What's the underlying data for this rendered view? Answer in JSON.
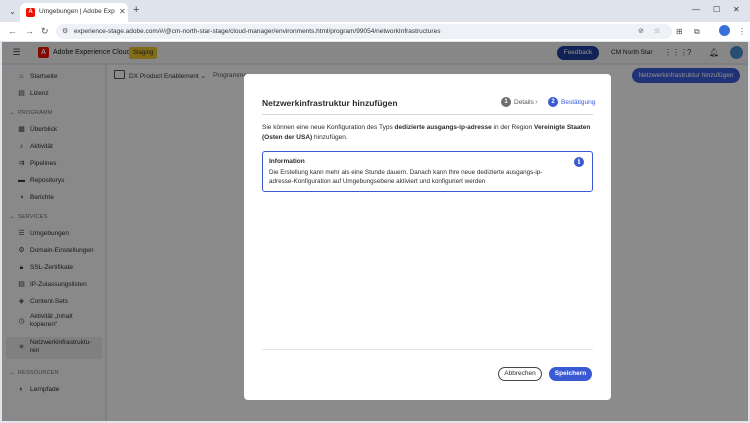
{
  "browser": {
    "tab_title": "Umgebungen | Adobe Experience",
    "url": "experience-stage.adobe.com/#/@cm-north-star-stage/cloud-manager/environments.html/program/99054/networkInfrastructures"
  },
  "header": {
    "brand": "Adobe Experience Cloud",
    "env_badge": "Staging",
    "feedback_label": "Feedback",
    "org_name": "CM North Star"
  },
  "sidebar": {
    "top_items": [
      {
        "label": "Startseite",
        "icon": "home-icon"
      },
      {
        "label": "Lizenz",
        "icon": "license-icon"
      }
    ],
    "sections": [
      {
        "title": "PROGRAMM",
        "items": [
          {
            "label": "Überblick",
            "icon": "overview-icon"
          },
          {
            "label": "Aktivität",
            "icon": "bell-icon"
          },
          {
            "label": "Pipelines",
            "icon": "pipeline-icon"
          },
          {
            "label": "Repositorys",
            "icon": "folder-icon"
          },
          {
            "label": "Berichte",
            "icon": "report-icon"
          }
        ]
      },
      {
        "title": "SERVICES",
        "items": [
          {
            "label": "Umgebungen",
            "icon": "database-icon"
          },
          {
            "label": "Domain-Einstellungen",
            "icon": "gear-icon"
          },
          {
            "label": "SSL-Zertifikate",
            "icon": "lock-icon"
          },
          {
            "label": "IP-Zulassungslisten",
            "icon": "list-icon"
          },
          {
            "label": "Content-Sets",
            "icon": "box-icon"
          },
          {
            "label": "Aktivität „Inhalt kopieren“",
            "icon": "history-icon"
          },
          {
            "label": "Netzwerkinfrastruktu­ren",
            "icon": "network-icon"
          }
        ]
      },
      {
        "title": "RESSOURCEN",
        "items": [
          {
            "label": "Lernpfade",
            "icon": "compass-icon"
          }
        ]
      }
    ]
  },
  "main": {
    "breadcrumb": "DX Product Enablement",
    "breadcrumb_next": "Programme",
    "add_button": "Netzwerkinfrastruktur hinzufügen"
  },
  "dialog": {
    "title": "Netzwerkinfrastruktur hinzufügen",
    "steps": [
      {
        "number": "1",
        "label": "Details",
        "state": "done"
      },
      {
        "number": "2",
        "label": "Bestätigung",
        "state": "active"
      }
    ],
    "body_prefix": "Sie können eine neue Konfiguration des Typs ",
    "body_type": "dedizierte ausgangs-ip-adresse",
    "body_mid": " in der Region ",
    "body_region": "Vereinigte Staaten (Osten der USA)",
    "body_suffix": " hinzufügen.",
    "info_title": "Information",
    "info_text": "Die Erstellung kann mehr als eine Stunde dauern. Danach kann Ihre neue dedizierte ausgangs-ip-adresse-Konfiguration auf Umgebungsebene aktiviert und konfiguriert werden",
    "cancel_label": "Abbrechen",
    "save_label": "Speichern"
  },
  "colors": {
    "accent": "#3a5ad4",
    "feedback": "#1f3f9a",
    "staging": "#e8c12e",
    "adobe_red": "#eb1000"
  }
}
